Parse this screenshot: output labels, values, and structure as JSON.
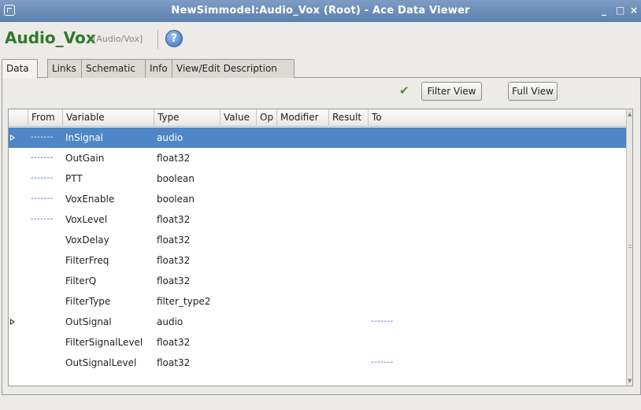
{
  "window": {
    "title": "NewSimmodel:Audio_Vox (Root) - Ace Data Viewer",
    "minimize": "_",
    "maximize": "□",
    "close": "×"
  },
  "header": {
    "object_name": "Audio_Vox",
    "object_path": "[Audio/Vox]",
    "help_glyph": "?"
  },
  "tabs": [
    {
      "label": "Data",
      "active": true
    },
    {
      "label": "Links",
      "active": false
    },
    {
      "label": "Schematic",
      "active": false
    },
    {
      "label": "Info",
      "active": false
    },
    {
      "label": "View/Edit Description",
      "active": false
    }
  ],
  "toolbar": {
    "check_icon": "check-icon",
    "filter_view_label": "Filter View",
    "full_view_label": "Full View"
  },
  "table": {
    "columns": [
      "From",
      "Variable",
      "Type",
      "Value",
      "Op",
      "Modifier",
      "Result",
      "To"
    ],
    "rows": [
      {
        "from": "-------",
        "variable": "InSignal",
        "type": "audio",
        "to": "",
        "expandable": true,
        "selected": true
      },
      {
        "from": "-------",
        "variable": "OutGain",
        "type": "float32",
        "to": "",
        "expandable": false,
        "selected": false
      },
      {
        "from": "-------",
        "variable": "PTT",
        "type": "boolean",
        "to": "",
        "expandable": false,
        "selected": false
      },
      {
        "from": "-------",
        "variable": "VoxEnable",
        "type": "boolean",
        "to": "",
        "expandable": false,
        "selected": false
      },
      {
        "from": "-------",
        "variable": "VoxLevel",
        "type": "float32",
        "to": "",
        "expandable": false,
        "selected": false
      },
      {
        "from": "",
        "variable": "VoxDelay",
        "type": "float32",
        "to": "",
        "expandable": false,
        "selected": false
      },
      {
        "from": "",
        "variable": "FilterFreq",
        "type": "float32",
        "to": "",
        "expandable": false,
        "selected": false
      },
      {
        "from": "",
        "variable": "FilterQ",
        "type": "float32",
        "to": "",
        "expandable": false,
        "selected": false
      },
      {
        "from": "",
        "variable": "FilterType",
        "type": "filter_type2",
        "to": "",
        "expandable": false,
        "selected": false
      },
      {
        "from": "",
        "variable": "OutSignal",
        "type": "audio",
        "to": "-------",
        "expandable": true,
        "selected": false
      },
      {
        "from": "",
        "variable": "FilterSignalLevel",
        "type": "float32",
        "to": "",
        "expandable": false,
        "selected": false
      },
      {
        "from": "",
        "variable": "OutSignalLevel",
        "type": "float32",
        "to": "-------",
        "expandable": false,
        "selected": false
      }
    ]
  },
  "colors": {
    "title_bar": "#6a8bb9",
    "object_name": "#2e7a2a",
    "selection": "#4f86c6",
    "dash_link": "#3b5fc7"
  }
}
